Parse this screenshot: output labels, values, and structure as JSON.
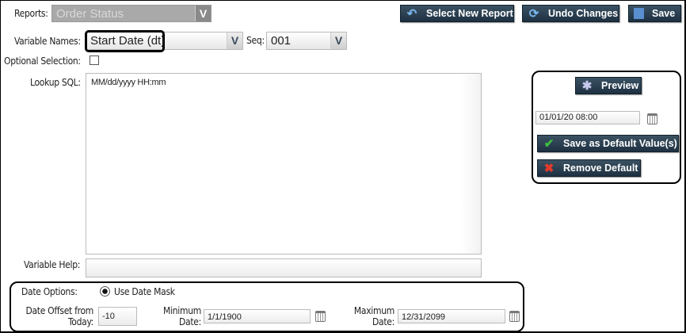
{
  "reports": {
    "label": "Reports:",
    "value": "Order Status"
  },
  "toolbar": {
    "select_new_report": "Select New Report",
    "undo_changes": "Undo Changes",
    "save": "Save"
  },
  "variable": {
    "label": "Variable Names:",
    "value": "Start Date (dt)",
    "seq_label": "Seq:",
    "seq_value": "001"
  },
  "optional": {
    "label": "Optional Selection:",
    "checked": false
  },
  "lookup": {
    "label": "Lookup SQL:",
    "value": "MM/dd/yyyy HH:mm"
  },
  "help": {
    "label": "Variable Help:",
    "value": ""
  },
  "preview_panel": {
    "preview": "Preview",
    "date_value": "01/01/20   08:00",
    "save_default": "Save as Default Value(s)",
    "remove_default": "Remove Default"
  },
  "date_options": {
    "label": "Date Options:",
    "mask_label": "Use Date Mask",
    "offset_label_1": "Date Offset from",
    "offset_label_2": "Today:",
    "offset_value": "-10",
    "min_label_1": "Minimum",
    "min_label_2": "Date:",
    "min_value": "1/1/1900",
    "max_label_1": "Maximum",
    "max_label_2": "Date:",
    "max_value": "12/31/2099"
  }
}
